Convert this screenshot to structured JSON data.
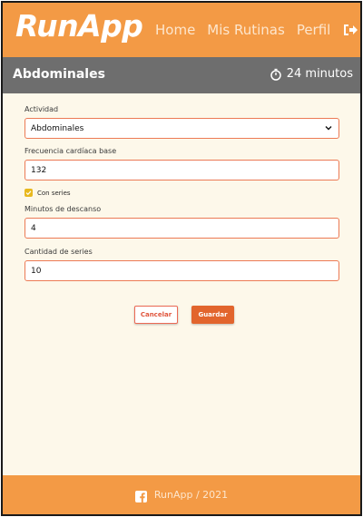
{
  "header": {
    "brand": "RunApp",
    "nav": [
      "Home",
      "Mis Rutinas",
      "Perfil"
    ],
    "logout_icon": "sign-out-icon"
  },
  "section": {
    "title": "Abdominales",
    "duration": "24 minutos",
    "duration_icon": "stopwatch-icon"
  },
  "form": {
    "activity": {
      "label": "Actividad",
      "value": "Abdominales"
    },
    "heart_rate": {
      "label": "Frecuencia cardíaca  base",
      "value": "132"
    },
    "with_series": {
      "label": "Con series",
      "checked": true
    },
    "rest_minutes": {
      "label": "Minutos de descanso",
      "value": "4"
    },
    "series_count": {
      "label": "Cantidad de series",
      "value": "10"
    }
  },
  "actions": {
    "cancel": "Cancelar",
    "save": "Guardar"
  },
  "footer": {
    "text": "RunApp / 2021",
    "icon": "facebook-icon"
  },
  "colors": {
    "primary": "#f39a45",
    "section_bar": "#6e6e6e",
    "background": "#fdf8ea",
    "input_border": "#ec7a55",
    "save_button": "#e2652d",
    "checkbox": "#e8b81e"
  }
}
